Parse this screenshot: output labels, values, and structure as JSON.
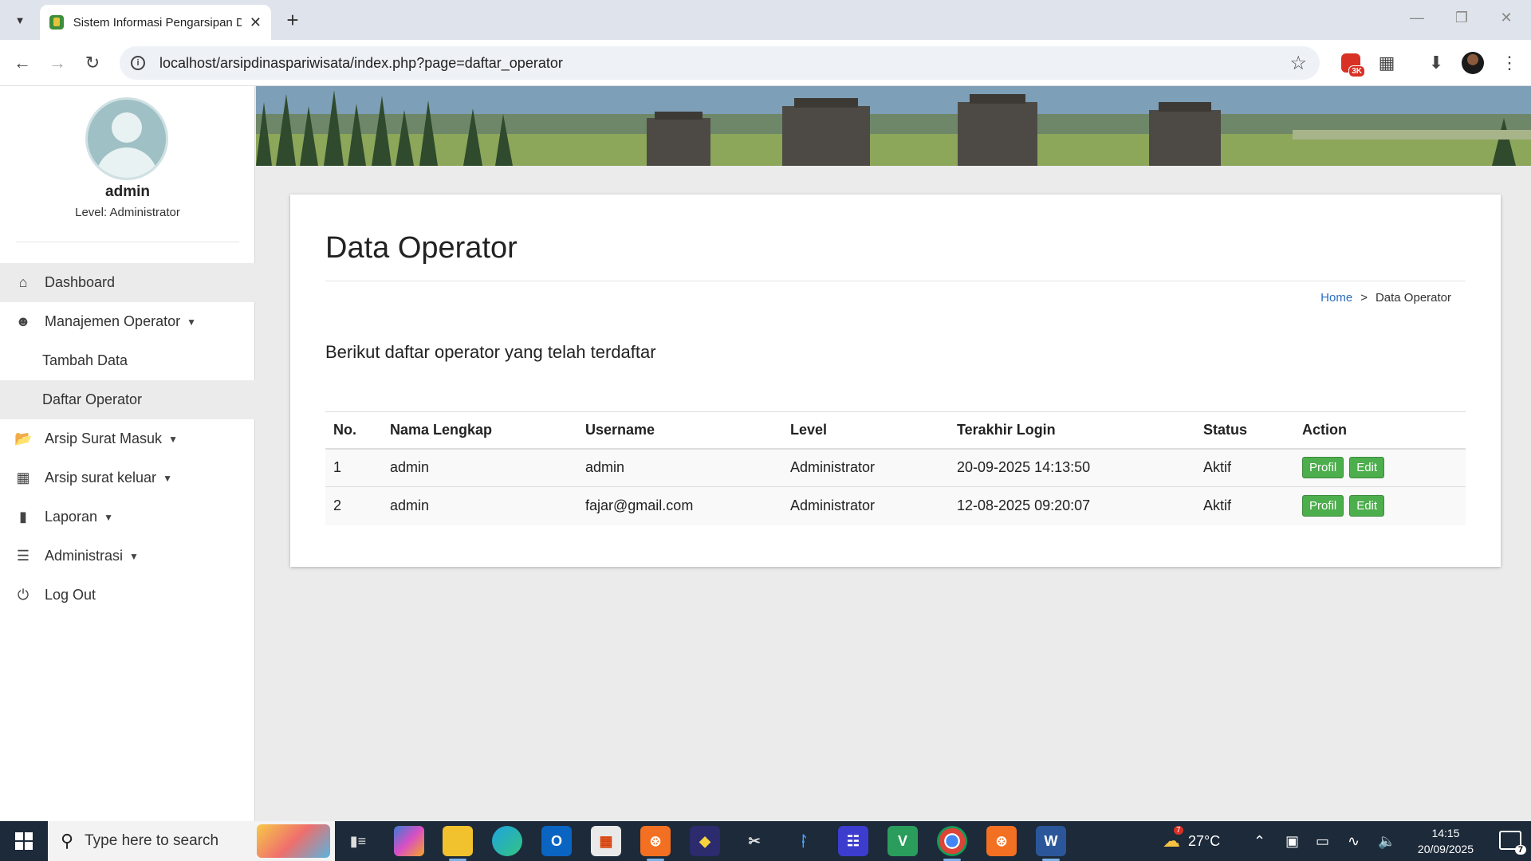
{
  "browser": {
    "tab_title": "Sistem Informasi Pengarsipan D",
    "url": "localhost/arsipdinaspariwisata/index.php?page=daftar_operator",
    "extension_badge": "3K"
  },
  "sidebar": {
    "user_name": "admin",
    "user_level": "Level: Administrator",
    "menu": [
      {
        "label": "Dashboard",
        "icon": "home-icon"
      },
      {
        "label": "Manajemen Operator",
        "icon": "user-icon"
      },
      {
        "label": "Tambah Data"
      },
      {
        "label": "Daftar Operator"
      },
      {
        "label": "Arsip Surat Masuk",
        "icon": "folder-open-icon"
      },
      {
        "label": "Arsip surat keluar",
        "icon": "folder-icon"
      },
      {
        "label": "Laporan",
        "icon": "book-icon"
      },
      {
        "label": "Administrasi",
        "icon": "server-icon"
      },
      {
        "label": "Log Out",
        "icon": "power-icon"
      }
    ]
  },
  "main": {
    "title": "Data Operator",
    "breadcrumb": {
      "home": "Home",
      "separator": ">",
      "current": "Data Operator"
    },
    "lead": "Berikut daftar operator yang telah terdaftar",
    "table": {
      "headers": [
        "No.",
        "Nama Lengkap",
        "Username",
        "Level",
        "Terakhir Login",
        "Status",
        "Action"
      ],
      "rows": [
        {
          "no": "1",
          "nama": "admin",
          "username": "admin",
          "level": "Administrator",
          "login": "20-09-2025 14:13:50",
          "status": "Aktif"
        },
        {
          "no": "2",
          "nama": "admin",
          "username": "fajar@gmail.com",
          "level": "Administrator",
          "login": "12-08-2025 09:20:07",
          "status": "Aktif"
        }
      ],
      "btn_profil": "Profil",
      "btn_edit": "Edit"
    }
  },
  "taskbar": {
    "search_placeholder": "Type here to search",
    "weather_temp": "27°C",
    "weather_badge": "7",
    "time": "14:15",
    "date": "20/09/2025",
    "notifications": "7"
  },
  "colors": {
    "button_green": "#4cae4c",
    "link_blue": "#2a6dbd",
    "taskbar": "#1c2a3a"
  }
}
